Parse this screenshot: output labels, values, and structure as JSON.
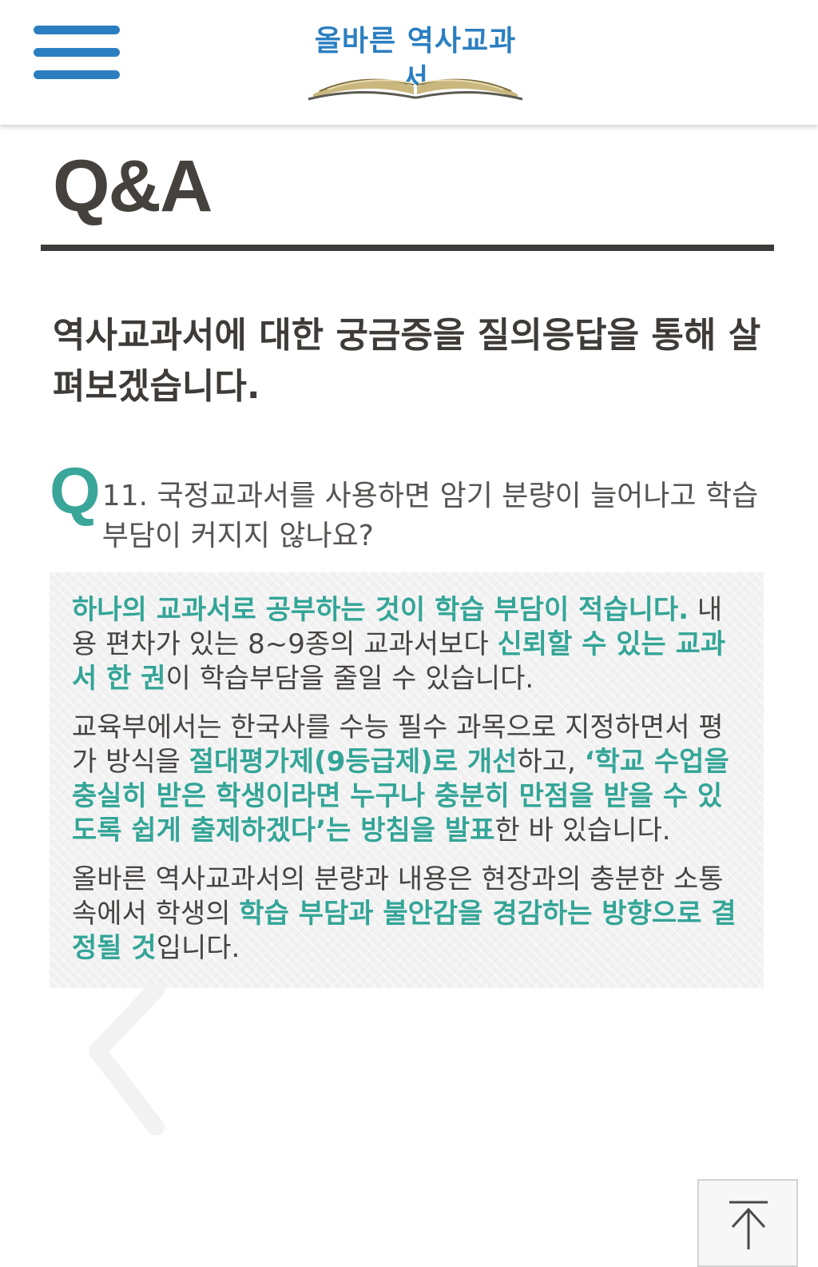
{
  "header": {
    "menu_icon": "hamburger-menu-icon",
    "logo_text": "올바른 역사교과서",
    "logo_icon": "open-book-icon"
  },
  "page": {
    "title": "Q&A",
    "intro": "역사교과서에 대한 궁금증을 질의응답을 통해 살펴보겠습니다."
  },
  "question": {
    "letter": "Q",
    "text": "11. 국정교과서를 사용하면 암기 분량이 늘어나고 학습 부담이 커지지 않나요?"
  },
  "answer": {
    "p1": [
      {
        "t": "하나의 교과서로 공부하는 것이 학습 부담이 적습니다.",
        "hl": true
      },
      {
        "t": " 내용 편차가 있는 8~9종의 교과서보다 ",
        "hl": false
      },
      {
        "t": "신뢰할 수 있는 교과서 한 권",
        "hl": true
      },
      {
        "t": "이 학습부담을 줄일 수 있습니다.",
        "hl": false
      }
    ],
    "p2": [
      {
        "t": "교육부에서는 한국사를 수능 필수 과목으로 지정하면서 평가 방식을 ",
        "hl": false
      },
      {
        "t": "절대평가제(9등급제)로 개선",
        "hl": true
      },
      {
        "t": "하고, ",
        "hl": false
      },
      {
        "t": "‘학교 수업을 충실히 받은 학생이라면 누구나 충분히 만점을 받을 수 있도록 쉽게 출제하겠다’는 방침을 발표",
        "hl": true
      },
      {
        "t": "한 바 있습니다.",
        "hl": false
      }
    ],
    "p3": [
      {
        "t": "올바른 역사교과서의 분량과 내용은 현장과의 충분한 소통 속에서 학생의 ",
        "hl": false
      },
      {
        "t": "학습 부담과 불안감을 경감하는 방향으로 결정될 것",
        "hl": true
      },
      {
        "t": "입니다.",
        "hl": false
      }
    ]
  },
  "controls": {
    "back_icon": "chevron-left-icon",
    "top_icon": "arrow-up-to-top-icon"
  },
  "colors": {
    "accent_blue": "#2b7fc1",
    "accent_teal": "#33a597",
    "text_dark": "#3e3b38"
  }
}
